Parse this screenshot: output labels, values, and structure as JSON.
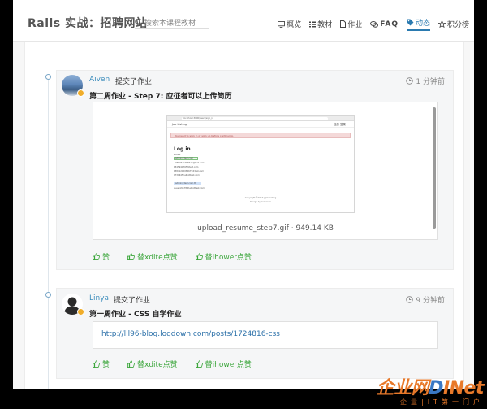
{
  "header": {
    "brand": "Rails 实战：招聘网站",
    "search_placeholder": "搜索本课程教材",
    "nav": [
      {
        "icon": "monitor-icon",
        "label": "概览"
      },
      {
        "icon": "list-icon",
        "label": "教材"
      },
      {
        "icon": "document-icon",
        "label": "作业"
      },
      {
        "icon": "chat-icon",
        "label": "FAQ"
      },
      {
        "icon": "tag-icon",
        "label": "动态"
      },
      {
        "icon": "star-icon",
        "label": "积分榜"
      }
    ]
  },
  "feed": [
    {
      "username": "Aiven",
      "action": "提交了作业",
      "time": "1 分钟前",
      "title": "第二周作业 - Step 7: 应征者可以上传简历",
      "attachment": {
        "filename": "upload_resume_step7.gif · 949.14 KB",
        "preview": {
          "browser_address": "localhost:3000/users/sign_in",
          "brand": "Job Listing",
          "nav_right": "注册  登录",
          "alert": "You need to sign in or sign up before continuing.",
          "heading": "Log in",
          "field_label": "Email",
          "autocomplete": [
            "admin@test.com",
            "~9889471098715@test.com",
            "1345949765@test.com",
            "13871295086675@test.com",
            "9730645hello@test.com",
            "admin@test.com.tt",
            "xueshi@1789hello@test.com"
          ],
          "footer_line1": "Copyright ©2017 | Job Listing",
          "footer_line2": "Design by xxxxxxxx"
        }
      },
      "likes": [
        "赞",
        "替xdite点赞",
        "替ihower点赞"
      ]
    },
    {
      "username": "Linya",
      "action": "提交了作业",
      "time": "9 分钟前",
      "title": "第一周作业 - CSS 自学作业",
      "link": "http://lll96-blog.logdown.com/posts/1724816-css",
      "likes": [
        "赞",
        "替xdite点赞",
        "替ihower点赞"
      ]
    }
  ],
  "watermark": {
    "main_orange": "企业网",
    "main_blue": "D",
    "main_rest": "INet",
    "sub": "企业|IT第一门户"
  },
  "colors": {
    "accent": "#2a7ab0",
    "link": "#3c8dbc",
    "like": "#3ba63b",
    "badge": "#f0ad2a",
    "watermark": "#e8792a"
  }
}
